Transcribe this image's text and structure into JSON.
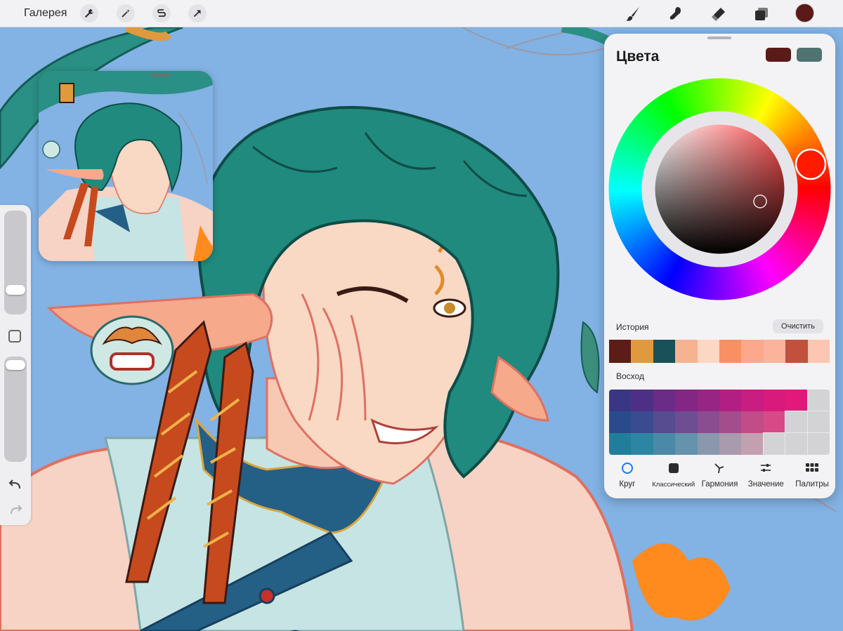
{
  "toolbar": {
    "gallery_label": "Галерея",
    "left_tools": [
      "wrench-icon",
      "magic-wand-icon",
      "selection-icon",
      "transform-arrow-icon"
    ],
    "right_tools": [
      "brush-icon",
      "smudge-icon",
      "eraser-icon",
      "layers-icon"
    ],
    "current_color": "#5a1a17"
  },
  "panel": {
    "title": "Цвета",
    "primary_swatch": "#5a1a17",
    "secondary_swatch": "#4f7370",
    "history_label": "История",
    "clear_label": "Очистить",
    "history_colors": [
      "#5c1d17",
      "#e09a3d",
      "#1a5057",
      "#f7b391",
      "#fcd7c3",
      "#f99063",
      "#fca88d",
      "#fbb39b",
      "#c1513d",
      "#fcc6b0"
    ],
    "palette_label": "Восход",
    "palette_colors": [
      [
        "#3a3585",
        "#4e2f86",
        "#6a2c86",
        "#832785",
        "#962584",
        "#b11f83",
        "#c81d81",
        "#d81b7b",
        "#e2197a",
        "#d3d3d6"
      ],
      [
        "#2a4b8b",
        "#3a4b8f",
        "#564c8f",
        "#6d4e93",
        "#8a4d8f",
        "#a44d8c",
        "#c14c88",
        "#d74a87",
        "#d3d3d6",
        "#d3d3d6"
      ],
      [
        "#217e9b",
        "#2e85a3",
        "#4a8aa8",
        "#6592ad",
        "#8b97ad",
        "#a99aad",
        "#c3a0b0",
        "#d3d3d6",
        "#d3d3d6",
        "#d3d3d6"
      ]
    ],
    "tabs": [
      {
        "label": "Круг",
        "icon": "circle-icon",
        "active": true
      },
      {
        "label": "Классический",
        "icon": "square-icon",
        "active": false
      },
      {
        "label": "Гармония",
        "icon": "harmony-icon",
        "active": false
      },
      {
        "label": "Значение",
        "icon": "sliders-icon",
        "active": false
      },
      {
        "label": "Палитры",
        "icon": "grid-icon",
        "active": false
      }
    ],
    "accent_color": "#1c7cf2"
  },
  "sidebar": {
    "brush_size_level": 0.2,
    "opacity_level": 0.98
  }
}
